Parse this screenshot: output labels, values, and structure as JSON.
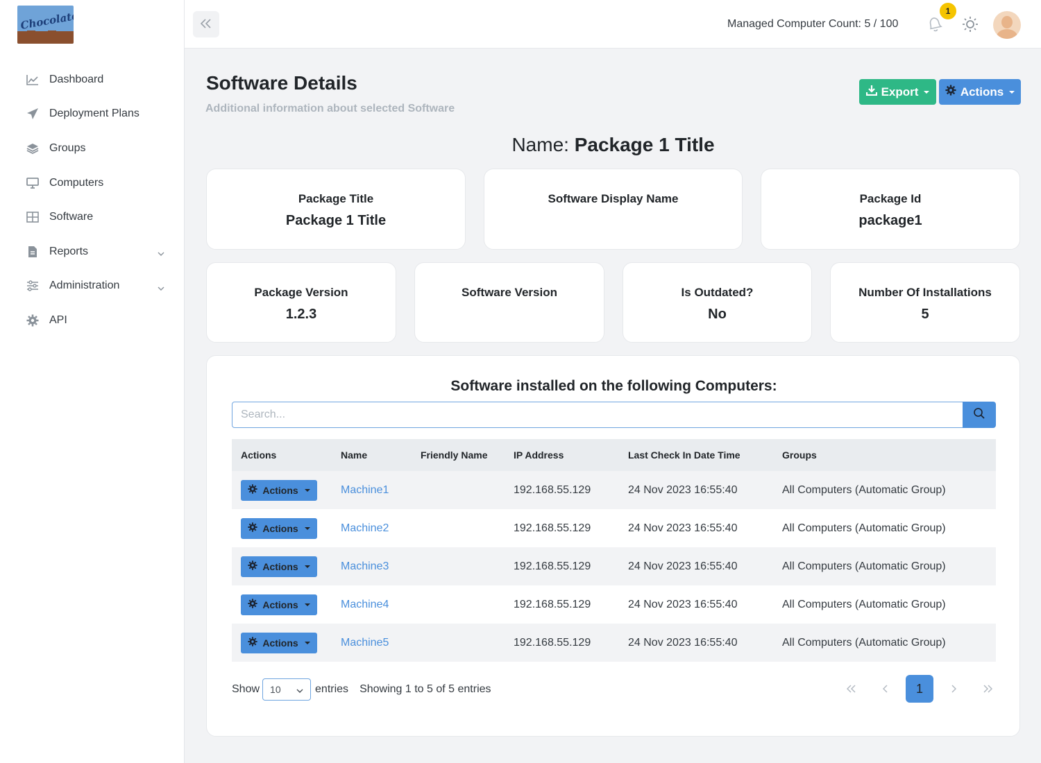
{
  "sidebar": {
    "logo_text": "Chocolatey",
    "items": [
      {
        "label": "Dashboard",
        "icon": "chart-line-icon",
        "has_submenu": false
      },
      {
        "label": "Deployment Plans",
        "icon": "paper-plane-icon",
        "has_submenu": false
      },
      {
        "label": "Groups",
        "icon": "layers-icon",
        "has_submenu": false
      },
      {
        "label": "Computers",
        "icon": "desktop-icon",
        "has_submenu": false
      },
      {
        "label": "Software",
        "icon": "grid-icon",
        "has_submenu": false
      },
      {
        "label": "Reports",
        "icon": "document-icon",
        "has_submenu": true
      },
      {
        "label": "Administration",
        "icon": "sliders-icon",
        "has_submenu": true
      },
      {
        "label": "API",
        "icon": "gear-icon",
        "has_submenu": false
      }
    ]
  },
  "topbar": {
    "managed_computer_count": "Managed Computer Count: 5 / 100",
    "notification_count": "1"
  },
  "header": {
    "title": "Software Details",
    "subtitle": "Additional information about selected Software",
    "export_label": "Export",
    "actions_label": "Actions"
  },
  "name_heading": {
    "prefix": "Name:",
    "value": "Package 1 Title"
  },
  "details": {
    "package_title": {
      "label": "Package Title",
      "value": "Package 1 Title"
    },
    "software_display_name": {
      "label": "Software Display Name",
      "value": ""
    },
    "package_id": {
      "label": "Package Id",
      "value": "package1"
    },
    "package_version": {
      "label": "Package Version",
      "value": "1.2.3"
    },
    "software_version": {
      "label": "Software Version",
      "value": ""
    },
    "is_outdated": {
      "label": "Is Outdated?",
      "value": "No"
    },
    "number_of_installations": {
      "label": "Number Of Installations",
      "value": "5"
    }
  },
  "computers_table": {
    "title": "Software installed on the following Computers:",
    "search_placeholder": "Search...",
    "columns": [
      "Actions",
      "Name",
      "Friendly Name",
      "IP Address",
      "Last Check In Date Time",
      "Groups"
    ],
    "action_label": "Actions",
    "rows": [
      {
        "name": "Machine1",
        "friendly_name": "",
        "ip": "192.168.55.129",
        "last_check_in": "24 Nov 2023 16:55:40",
        "groups": "All Computers (Automatic Group)"
      },
      {
        "name": "Machine2",
        "friendly_name": "",
        "ip": "192.168.55.129",
        "last_check_in": "24 Nov 2023 16:55:40",
        "groups": "All Computers (Automatic Group)"
      },
      {
        "name": "Machine3",
        "friendly_name": "",
        "ip": "192.168.55.129",
        "last_check_in": "24 Nov 2023 16:55:40",
        "groups": "All Computers (Automatic Group)"
      },
      {
        "name": "Machine4",
        "friendly_name": "",
        "ip": "192.168.55.129",
        "last_check_in": "24 Nov 2023 16:55:40",
        "groups": "All Computers (Automatic Group)"
      },
      {
        "name": "Machine5",
        "friendly_name": "",
        "ip": "192.168.55.129",
        "last_check_in": "24 Nov 2023 16:55:40",
        "groups": "All Computers (Automatic Group)"
      }
    ],
    "show_label": "Show",
    "page_size": "10",
    "entries_label": "entries",
    "showing_text": "Showing 1 to 5 of 5 entries",
    "current_page": "1"
  },
  "colors": {
    "primary": "#4a8fdc",
    "success": "#2eb886",
    "warning_badge": "#f5c400"
  }
}
